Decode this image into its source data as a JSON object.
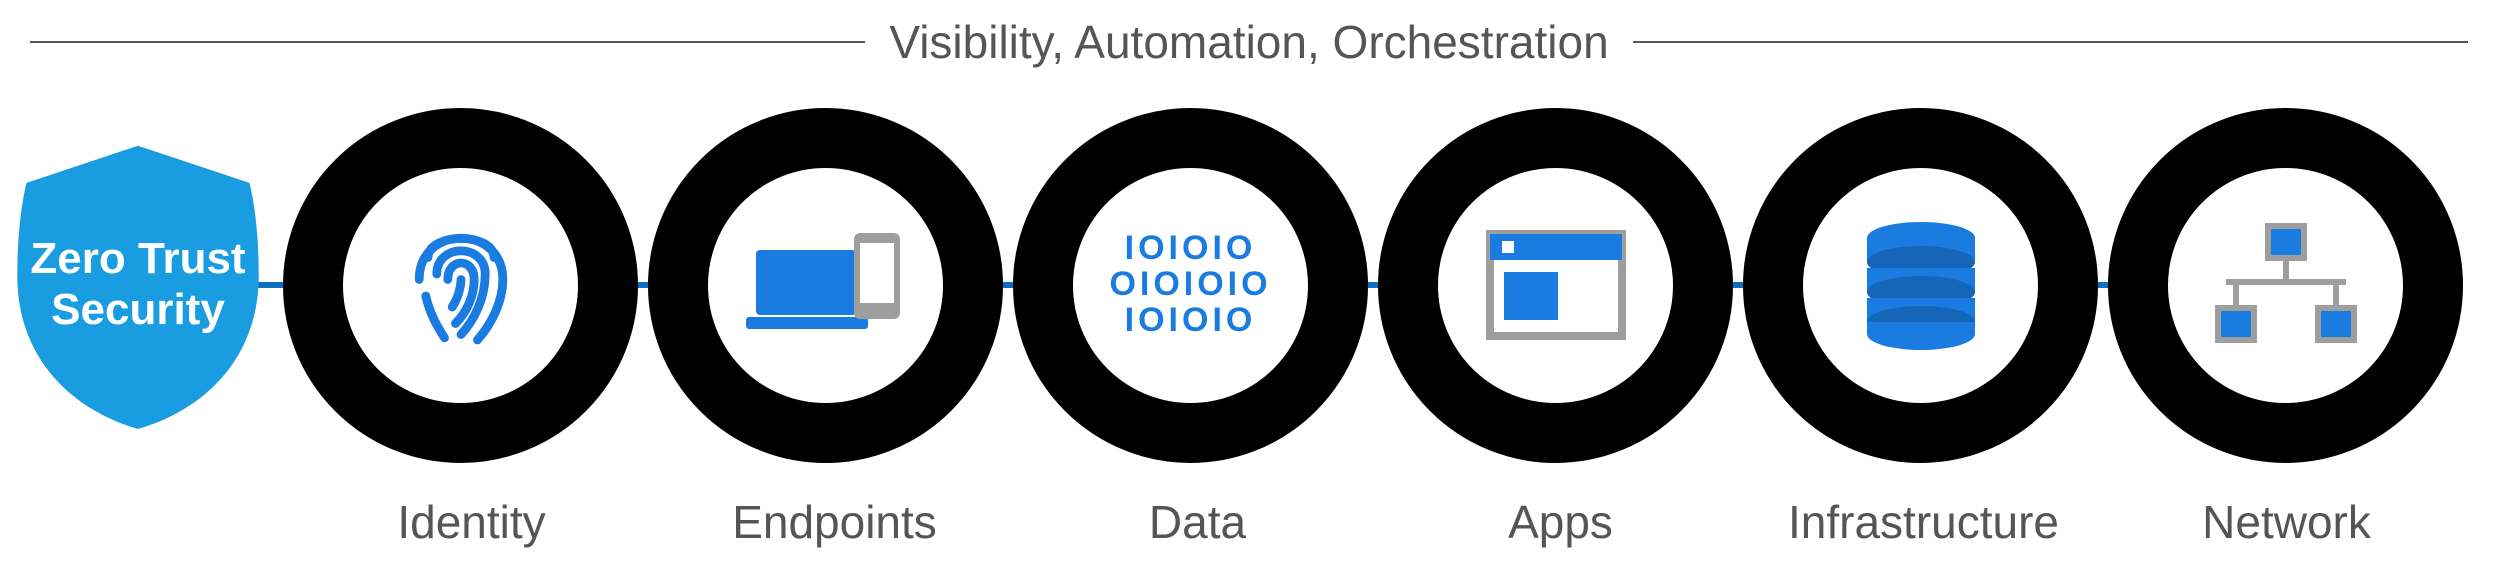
{
  "colors": {
    "accent_blue": "#1a7be0",
    "dark_blue": "#0a6fbf",
    "ring_black": "#000000",
    "text_gray": "#555555",
    "icon_gray": "#9e9e9e"
  },
  "header": {
    "title": "Visibility, Automation, Orchestration"
  },
  "shield": {
    "line1": "Zero Trust",
    "line2": "Security"
  },
  "pillars": [
    {
      "id": "identity",
      "label": "Identity",
      "icon": "fingerprint-icon"
    },
    {
      "id": "endpoints",
      "label": "Endpoints",
      "icon": "devices-icon"
    },
    {
      "id": "data",
      "label": "Data",
      "icon": "binary-icon",
      "binary_lines": [
        "IOIOIO",
        "OIOIOIO",
        "IOIOIO"
      ]
    },
    {
      "id": "apps",
      "label": "Apps",
      "icon": "app-window-icon"
    },
    {
      "id": "infrastructure",
      "label": "Infrastructure",
      "icon": "database-icon"
    },
    {
      "id": "network",
      "label": "Network",
      "icon": "network-icon"
    }
  ]
}
